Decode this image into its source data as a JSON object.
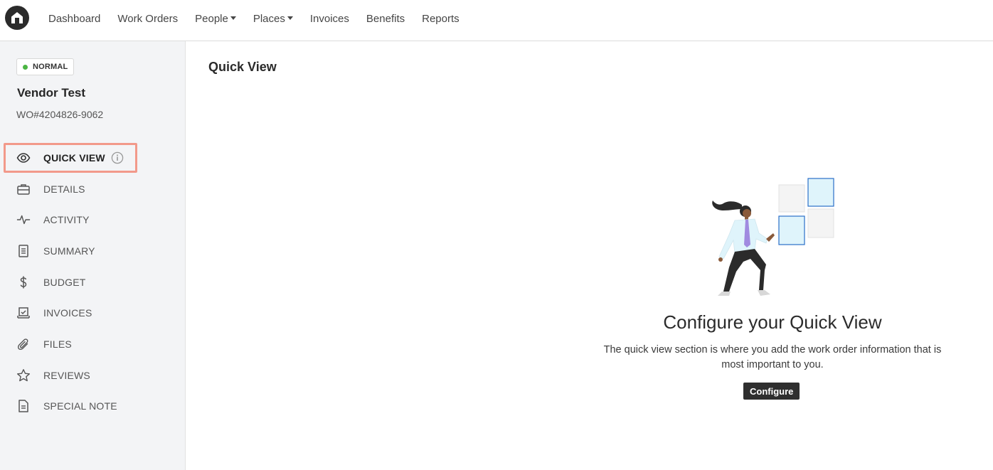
{
  "nav": {
    "items": [
      {
        "label": "Dashboard",
        "dropdown": false
      },
      {
        "label": "Work Orders",
        "dropdown": false
      },
      {
        "label": "People",
        "dropdown": true
      },
      {
        "label": "Places",
        "dropdown": true
      },
      {
        "label": "Invoices",
        "dropdown": false
      },
      {
        "label": "Benefits",
        "dropdown": false
      },
      {
        "label": "Reports",
        "dropdown": false
      }
    ]
  },
  "sidebar": {
    "status": "NORMAL",
    "status_color": "#4bb543",
    "vendor_name": "Vendor Test",
    "wo_number": "WO#4204826-9062",
    "items": [
      {
        "label": "QUICK VIEW",
        "icon": "eye-icon",
        "active": true
      },
      {
        "label": "DETAILS",
        "icon": "briefcase-icon"
      },
      {
        "label": "ACTIVITY",
        "icon": "activity-icon"
      },
      {
        "label": "SUMMARY",
        "icon": "document-icon"
      },
      {
        "label": "BUDGET",
        "icon": "dollar-icon"
      },
      {
        "label": "INVOICES",
        "icon": "invoice-icon"
      },
      {
        "label": "FILES",
        "icon": "paperclip-icon"
      },
      {
        "label": "REVIEWS",
        "icon": "star-icon"
      },
      {
        "label": "SPECIAL NOTE",
        "icon": "note-icon"
      }
    ]
  },
  "main": {
    "title": "Quick View",
    "empty_state": {
      "title": "Configure your Quick View",
      "description": "The quick view section is where you add the work order information that is most important to you.",
      "button_label": "Configure"
    }
  },
  "colors": {
    "highlight_border": "#f2998a",
    "accent_tile": "#dff4fb",
    "tile_border": "#2a6fc9"
  }
}
